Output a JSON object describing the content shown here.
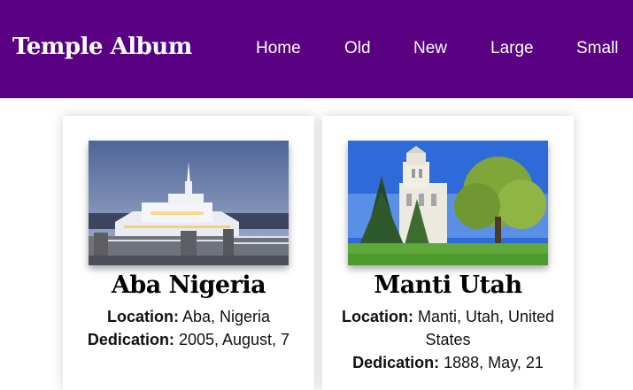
{
  "header": {
    "logo": "Temple Album",
    "nav": [
      "Home",
      "Old",
      "New",
      "Large",
      "Small"
    ]
  },
  "colors": {
    "header_bg": "#5a0082",
    "text": "#000000"
  },
  "temples": [
    {
      "name": "Aba Nigeria",
      "location_label": "Location:",
      "location": "Aba, Nigeria",
      "dedication_label": "Dedication:",
      "dedication": "2005, August, 7",
      "photo": "aba-nigeria-temple-photo"
    },
    {
      "name": "Manti Utah",
      "location_label": "Location:",
      "location": "Manti, Utah, United States",
      "dedication_label": "Dedication:",
      "dedication": "1888, May, 21",
      "photo": "manti-utah-temple-photo"
    }
  ]
}
